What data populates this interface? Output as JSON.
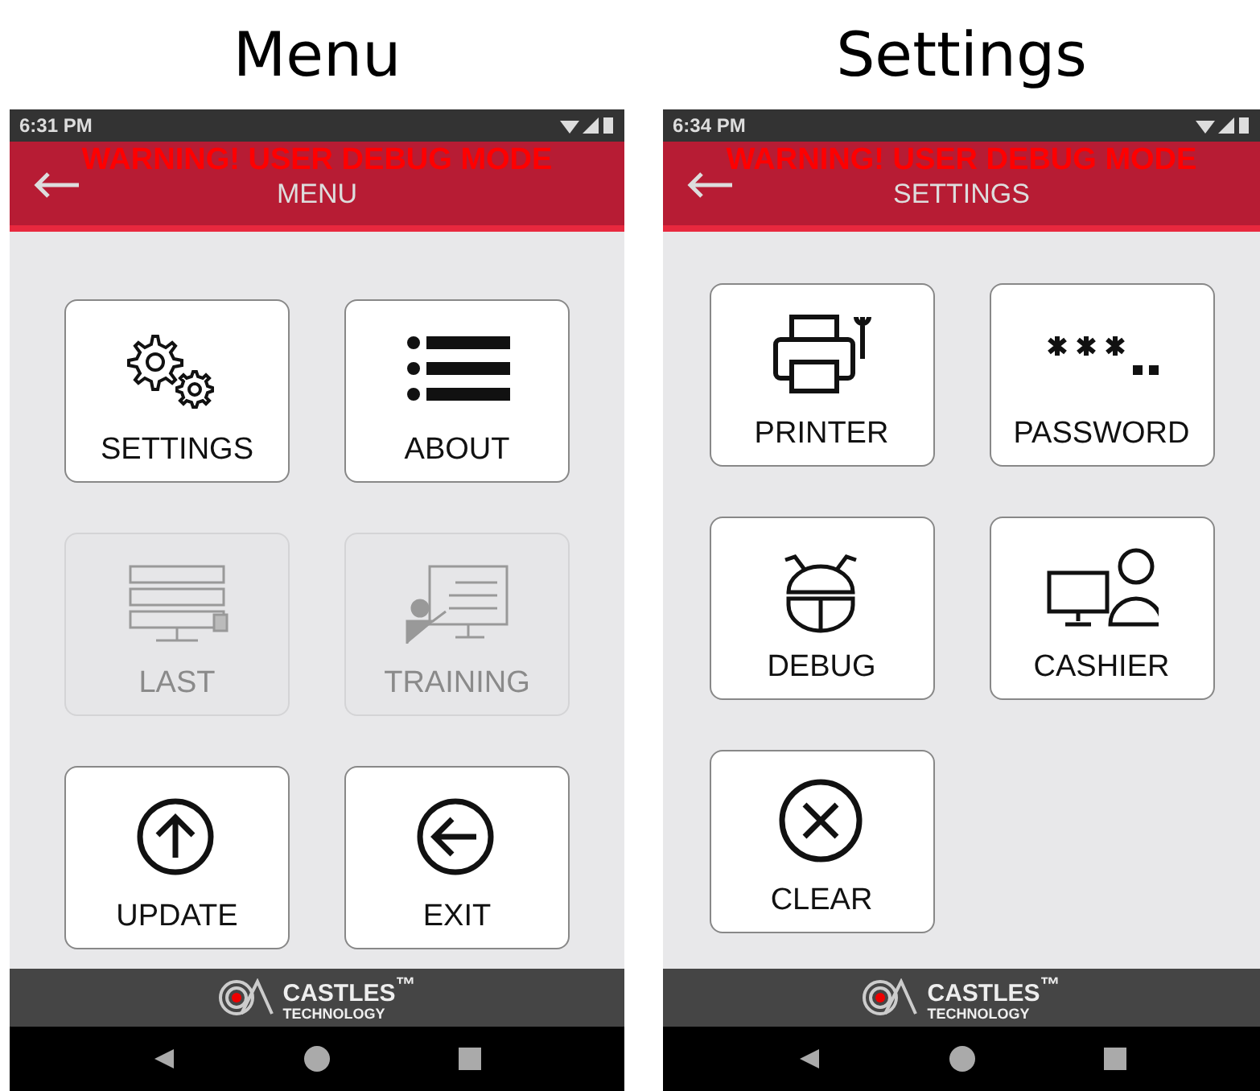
{
  "screens": [
    {
      "caption": "Menu",
      "status_bar": {
        "time": "6:31 PM"
      },
      "warning": "WARNING! USER DEBUG MODE",
      "title": "MENU",
      "tiles": [
        {
          "label": "SETTINGS",
          "kind": "gears",
          "disabled": false
        },
        {
          "label": "ABOUT",
          "kind": "list",
          "disabled": false
        },
        {
          "label": "LAST",
          "kind": "server",
          "disabled": true
        },
        {
          "label": "TRAINING",
          "kind": "training",
          "disabled": true
        },
        {
          "label": "UPDATE",
          "kind": "up",
          "disabled": false
        },
        {
          "label": "EXIT",
          "kind": "back",
          "disabled": false
        }
      ],
      "brand": {
        "name": "CASTLES$^{™}$",
        "sub": "TECHNOLOGY"
      }
    },
    {
      "caption": "Settings",
      "status_bar": {
        "time": "6:34 PM"
      },
      "warning": "WARNING! USER DEBUG MODE",
      "title": "SETTINGS",
      "tiles": [
        {
          "label": "PRINTER",
          "kind": "printer",
          "disabled": false
        },
        {
          "label": "PASSWORD",
          "kind": "password",
          "disabled": false
        },
        {
          "label": "DEBUG",
          "kind": "bug",
          "disabled": false
        },
        {
          "label": "CASHIER",
          "kind": "cashier",
          "disabled": false
        },
        {
          "label": "CLEAR",
          "kind": "clear",
          "disabled": false
        }
      ],
      "brand": {
        "name": "CASTLES$^{™}$",
        "sub": "TECHNOLOGY"
      }
    }
  ]
}
